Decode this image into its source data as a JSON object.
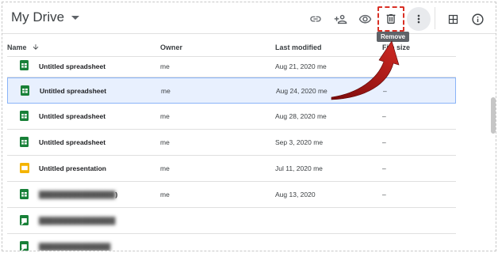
{
  "header": {
    "title": "My Drive",
    "tooltip": "Remove"
  },
  "toolbar": {
    "icons": [
      "link-icon",
      "add-person-icon",
      "preview-eye-icon",
      "trash-icon",
      "more-vert-icon",
      "details-grid-icon",
      "info-icon"
    ]
  },
  "columns": {
    "name": "Name",
    "owner": "Owner",
    "modified": "Last modified",
    "size": "File size"
  },
  "rows": [
    {
      "name": "Untitled spreadsheet",
      "type": "sheets",
      "owner": "me",
      "modified": "Aug 21, 2020",
      "modified_by": "me",
      "size": ""
    },
    {
      "name": "Untitled spreadsheet",
      "type": "sheets",
      "owner": "me",
      "modified": "Aug 24, 2020",
      "modified_by": "me",
      "size": "–"
    },
    {
      "name": "Untitled spreadsheet",
      "type": "sheets",
      "owner": "me",
      "modified": "Aug 28, 2020",
      "modified_by": "me",
      "size": "–"
    },
    {
      "name": "Untitled spreadsheet",
      "type": "sheets",
      "owner": "me",
      "modified": "Sep 3, 2020",
      "modified_by": "me",
      "size": "–"
    },
    {
      "name": "Untitled presentation",
      "type": "slides",
      "owner": "me",
      "modified": "Jul 11, 2020",
      "modified_by": "me",
      "size": "–"
    },
    {
      "name": ")",
      "type": "sheets",
      "owner": "me",
      "modified": "Aug 13, 2020",
      "modified_by": "",
      "size": "–"
    },
    {
      "name": "",
      "type": "shortcut",
      "owner": "",
      "modified": "",
      "modified_by": "",
      "size": ""
    },
    {
      "name": "",
      "type": "shortcut",
      "owner": "",
      "modified": "",
      "modified_by": "",
      "size": ""
    }
  ],
  "colors": {
    "sheets": "#188038",
    "slides": "#f4b400",
    "selected_bg": "#e8f0fe",
    "annotation": "#c5221f"
  }
}
